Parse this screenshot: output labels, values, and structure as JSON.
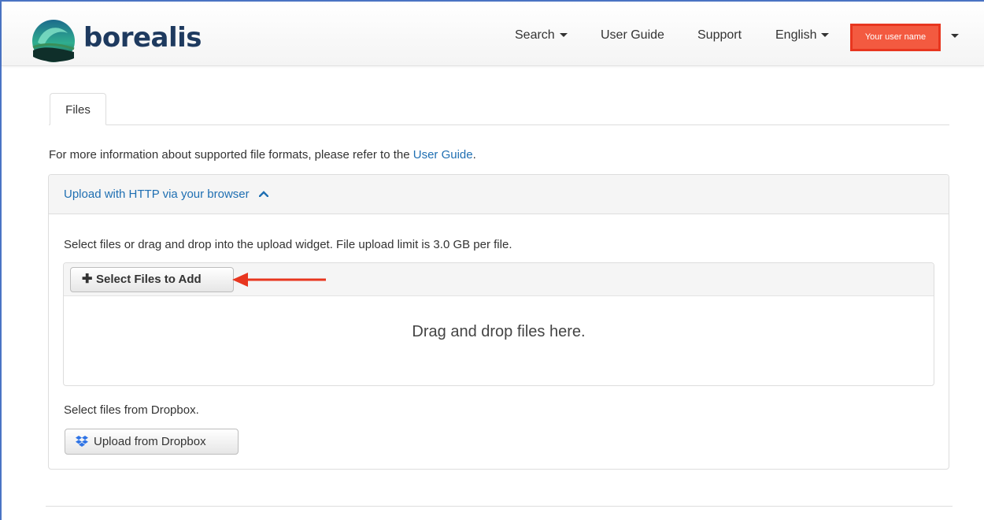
{
  "header": {
    "brand": "borealis",
    "nav": {
      "search": "Search",
      "user_guide": "User Guide",
      "support": "Support",
      "language": "English",
      "user_name": "Your user name"
    }
  },
  "tabs": [
    "Files"
  ],
  "info": {
    "prefix": "For more information about supported file formats, please refer to the ",
    "link": "User Guide",
    "suffix": "."
  },
  "upload_panel": {
    "title": "Upload with HTTP via your browser",
    "help": "Select files or drag and drop into the upload widget. File upload limit is 3.0 GB per file.",
    "select_button": "Select Files to Add",
    "drop_text": "Drag and drop files here.",
    "dropbox_help": "Select files from Dropbox.",
    "dropbox_button": "Upload from Dropbox"
  },
  "colors": {
    "link": "#1f6fb2",
    "annotation": "#e8361f",
    "brand_text": "#1e3a5f"
  },
  "icons": [
    "borealis-logo-icon",
    "caret-down-icon",
    "chevron-up-icon",
    "plus-icon",
    "dropbox-icon",
    "annotation-arrow-icon"
  ]
}
